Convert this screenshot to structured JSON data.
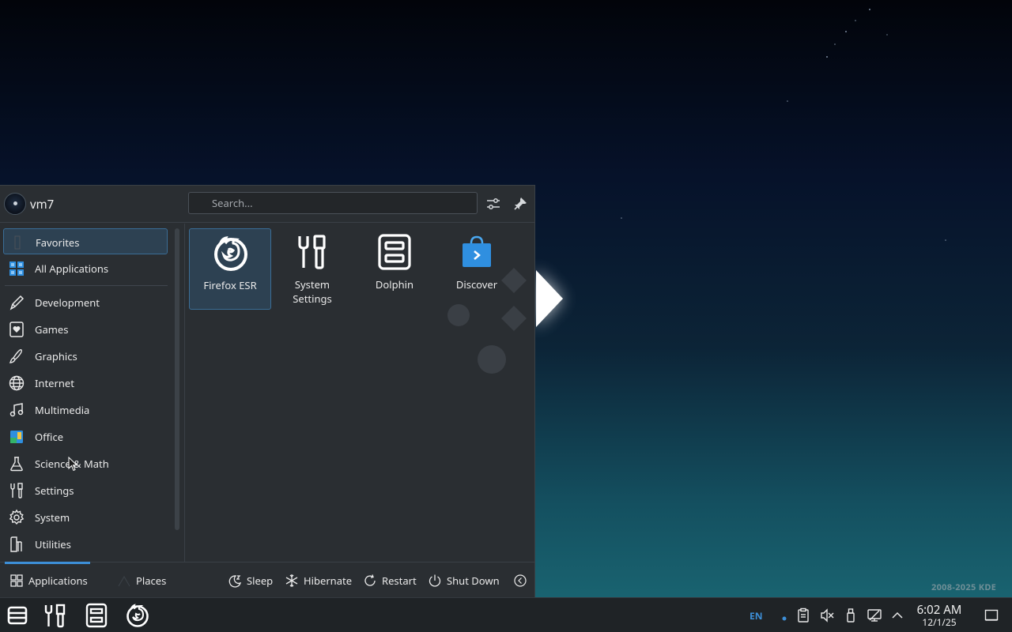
{
  "desktop": {
    "watermark": "2008-2025 KDE"
  },
  "launcher": {
    "user": "vm7",
    "search": {
      "placeholder": "Search..."
    },
    "categories": [
      {
        "label": "Favorites",
        "icon": "bookmark-icon"
      },
      {
        "label": "All Applications",
        "icon": "grid-icon"
      },
      {
        "label": "Development",
        "icon": "pen-icon"
      },
      {
        "label": "Games",
        "icon": "heart-card-icon"
      },
      {
        "label": "Graphics",
        "icon": "brush-icon"
      },
      {
        "label": "Internet",
        "icon": "globe-icon"
      },
      {
        "label": "Multimedia",
        "icon": "music-icon"
      },
      {
        "label": "Office",
        "icon": "office-icon"
      },
      {
        "label": "Science & Math",
        "icon": "flask-icon"
      },
      {
        "label": "Settings",
        "icon": "tools-icon"
      },
      {
        "label": "System",
        "icon": "gear-icon"
      },
      {
        "label": "Utilities",
        "icon": "utilities-icon"
      }
    ],
    "apps": [
      {
        "label": "Firefox ESR",
        "icon": "firefox-icon"
      },
      {
        "label": "System Settings",
        "icon": "system-settings-icon"
      },
      {
        "label": "Dolphin",
        "icon": "dolphin-icon"
      },
      {
        "label": "Discover",
        "icon": "discover-icon"
      }
    ],
    "footer": {
      "tabs": [
        {
          "label": "Applications"
        },
        {
          "label": "Places"
        }
      ],
      "actions": [
        {
          "label": "Sleep"
        },
        {
          "label": "Hibernate"
        },
        {
          "label": "Restart"
        },
        {
          "label": "Shut Down"
        }
      ]
    }
  },
  "taskbar": {
    "language": "EN",
    "time": "6:02 AM",
    "date": "12/1/25"
  },
  "colors": {
    "accent": "#3d8fd8",
    "panel": "#2a2e32",
    "taskbar": "#1f2326"
  }
}
